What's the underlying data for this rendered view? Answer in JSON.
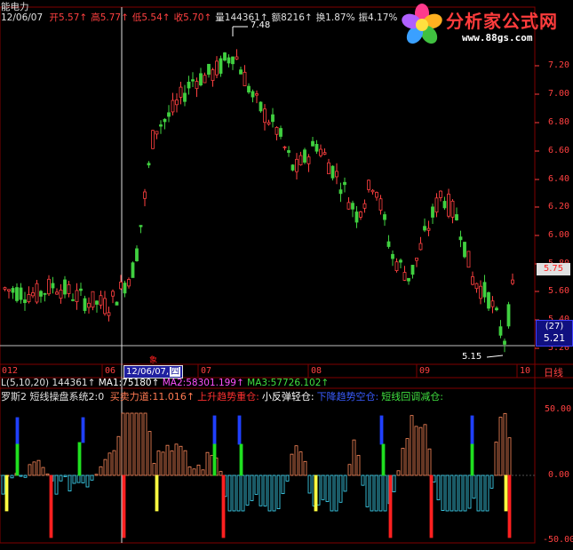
{
  "header": {
    "stock_name": "能电力",
    "date": "12/06/07",
    "fields": [
      {
        "label": "开",
        "value": "5.57",
        "arrow": "↑",
        "color": "#ff4040"
      },
      {
        "label": "高",
        "value": "5.77",
        "arrow": "↑",
        "color": "#ff4040"
      },
      {
        "label": "低",
        "value": "5.54",
        "arrow": "↑",
        "color": "#ff4040"
      },
      {
        "label": "收",
        "value": "5.70",
        "arrow": "↑",
        "color": "#ff4040"
      },
      {
        "label": "量",
        "value": "144361",
        "arrow": "↑",
        "color": "#e0e0e0"
      },
      {
        "label": "额",
        "value": "8216",
        "arrow": "↑",
        "color": "#e0e0e0"
      },
      {
        "label": "换",
        "value": "1.87%",
        "arrow": "",
        "color": "#e0e0e0"
      },
      {
        "label": "振",
        "value": "4.17%",
        "arrow": "",
        "color": "#e0e0e0"
      }
    ]
  },
  "logo": {
    "title": "分析家公式网",
    "url": "www.88gs.com",
    "icon": "flower-logo-icon"
  },
  "price_axis": {
    "labels": [
      "7.20",
      "7.00",
      "6.80",
      "6.60",
      "6.40",
      "6.20",
      "6.00",
      "5.80",
      "5.60",
      "5.40",
      "5.20"
    ],
    "current_price": "5.75",
    "counter": "(27)",
    "counter_price": "5.21"
  },
  "annotations": {
    "high_label": "7.48",
    "low_label": "5.15"
  },
  "date_axis": {
    "labels": [
      "012",
      "06",
      "07",
      "08",
      "09",
      "10"
    ],
    "cursor_date": "12/06/07,",
    "cursor_weekday": "四",
    "period_label": "日线",
    "marker": "象"
  },
  "ma_line": {
    "params": "L(5,10,20)",
    "value": "144361",
    "arrow": "↑",
    "ma1": "MA1:75180",
    "ma1_arrow": "↑",
    "ma2": "MA2:58301.199",
    "ma2_arrow": "↑",
    "ma3": "MA3:57726.102",
    "ma3_arrow": "↑"
  },
  "indicator_line": {
    "title": "罗斯2 短线操盘系统2:0",
    "items": [
      {
        "text": "买卖力道:11.016",
        "arrow": "↑",
        "color": "#ff7a52"
      },
      {
        "text": "上升趋势重仓:",
        "arrow": "",
        "color": "#ff3030"
      },
      {
        "text": "小反弹轻仓:",
        "arrow": "",
        "color": "#ffffff"
      },
      {
        "text": "下降趋势空仓:",
        "arrow": "",
        "color": "#3a5cff"
      },
      {
        "text": "短线回调减仓:",
        "arrow": "",
        "color": "#40e040"
      }
    ]
  },
  "indicator_axis": {
    "labels": [
      "50.00",
      "0.00",
      "-50.00"
    ]
  },
  "colors": {
    "up": "#ff4040",
    "down": "#40d040",
    "grid": "#800000",
    "axis_text": "#ff4040",
    "pos_bar": "#ff8a5c",
    "neg_bar": "#40e0ff",
    "blue": "#2040ff",
    "yellow": "#ffff40",
    "red": "#ff2020",
    "green": "#20e020"
  }
}
